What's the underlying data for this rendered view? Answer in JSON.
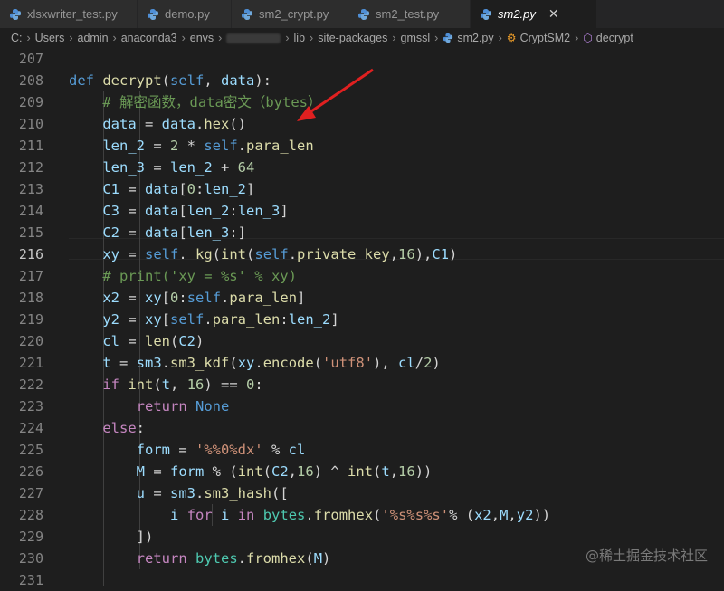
{
  "tabs": [
    {
      "label": "xlsxwriter_test.py"
    },
    {
      "label": "demo.py"
    },
    {
      "label": "sm2_crypt.py"
    },
    {
      "label": "sm2_test.py"
    },
    {
      "label": "sm2.py",
      "close": "✕"
    }
  ],
  "breadcrumb": {
    "path": [
      "C:",
      "Users",
      "admin",
      "anaconda3",
      "envs",
      "lib",
      "site-packages",
      "gmssl",
      "sm2.py",
      "CryptSM2",
      "decrypt"
    ]
  },
  "code": {
    "current_line": 216,
    "lines": [
      {
        "n": 207,
        "text": ""
      },
      {
        "n": 208,
        "text": "    def decrypt(self, data):"
      },
      {
        "n": 209,
        "text": "        # 解密函数，data密文（bytes）"
      },
      {
        "n": 210,
        "text": "        data = data.hex()"
      },
      {
        "n": 211,
        "text": "        len_2 = 2 * self.para_len"
      },
      {
        "n": 212,
        "text": "        len_3 = len_2 + 64"
      },
      {
        "n": 213,
        "text": "        C1 = data[0:len_2]"
      },
      {
        "n": 214,
        "text": "        C3 = data[len_2:len_3]"
      },
      {
        "n": 215,
        "text": "        C2 = data[len_3:]"
      },
      {
        "n": 216,
        "text": "        xy = self._kg(int(self.private_key,16),C1)"
      },
      {
        "n": 217,
        "text": "        # print('xy = %s' % xy)"
      },
      {
        "n": 218,
        "text": "        x2 = xy[0:self.para_len]"
      },
      {
        "n": 219,
        "text": "        y2 = xy[self.para_len:len_2]"
      },
      {
        "n": 220,
        "text": "        cl = len(C2)"
      },
      {
        "n": 221,
        "text": "        t = sm3.sm3_kdf(xy.encode('utf8'), cl/2)"
      },
      {
        "n": 222,
        "text": "        if int(t, 16) == 0:"
      },
      {
        "n": 223,
        "text": "            return None"
      },
      {
        "n": 224,
        "text": "        else:"
      },
      {
        "n": 225,
        "text": "            form = '%%0%dx' % cl"
      },
      {
        "n": 226,
        "text": "            M = form % (int(C2,16) ^ int(t,16))"
      },
      {
        "n": 227,
        "text": "            u = sm3.sm3_hash(["
      },
      {
        "n": 228,
        "text": "                i for i in bytes.fromhex('%s%s%s'% (x2,M,y2))"
      },
      {
        "n": 229,
        "text": "            ])"
      },
      {
        "n": 230,
        "text": "            return bytes.fromhex(M)"
      },
      {
        "n": 231,
        "text": ""
      }
    ]
  },
  "watermark": "@稀土掘金技术社区",
  "colors": {
    "arrow": "#e02020",
    "keyword": "#569cd6",
    "function": "#dcdcaa",
    "comment": "#6a9955",
    "string": "#ce9178"
  }
}
